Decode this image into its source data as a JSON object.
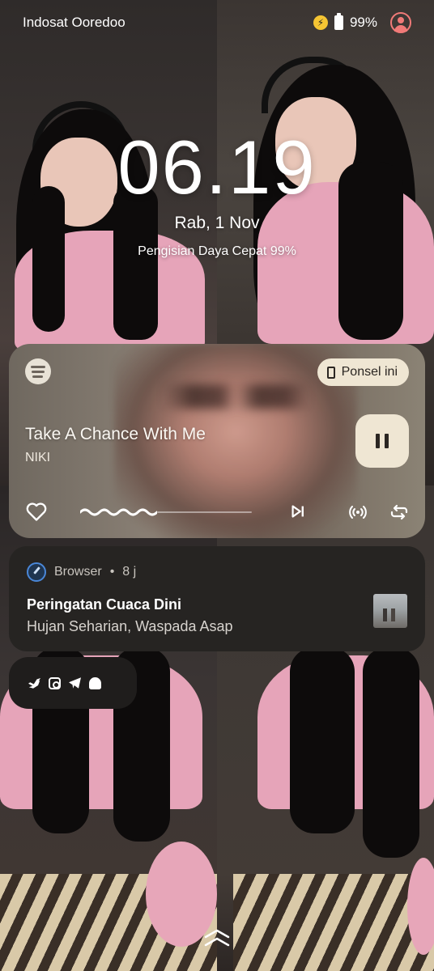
{
  "status_bar": {
    "carrier": "Indosat Ooredoo",
    "battery_percent": "99%",
    "charging_icon": "lightning-icon",
    "battery_icon": "battery-icon",
    "user_icon": "user-profile-icon"
  },
  "lockscreen": {
    "time": "06.19",
    "date": "Rab, 1 Nov",
    "charging_status": "Pengisian Daya Cepat 99%"
  },
  "media": {
    "app_icon": "spotify-icon",
    "output_device_label": "Ponsel ini",
    "track_title": "Take A Chance With Me",
    "artist": "NIKI",
    "playback_state": "playing",
    "progress_fraction": 0.45,
    "controls": [
      "heart-icon",
      "skip-next-icon",
      "cast-icon",
      "repeat-icon"
    ],
    "colors": {
      "chip_bg": "#efe6d3",
      "chip_text": "#2b2622"
    }
  },
  "notification": {
    "app_name": "Browser",
    "separator": "•",
    "time_ago": "8 j",
    "title": "Peringatan Cuaca Dini",
    "body": "Hujan Seharian, Waspada Asap",
    "app_icon": "browser-compass-icon"
  },
  "pinned_app_icons": [
    "twitter-icon",
    "instagram-icon",
    "telegram-icon",
    "cloud-icon"
  ],
  "unlock_hint_icon": "chevron-up-icon"
}
